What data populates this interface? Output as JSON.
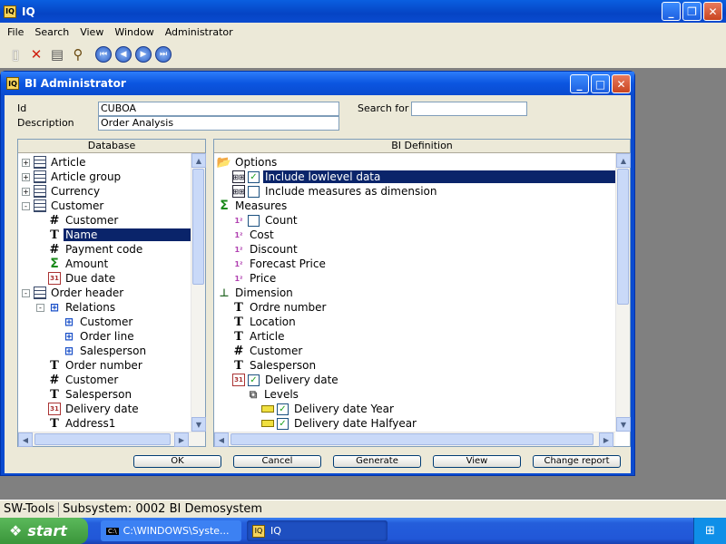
{
  "app": {
    "title": "IQ",
    "menu": [
      "File",
      "Search",
      "View",
      "Window",
      "Administrator"
    ],
    "toolbar_icons": [
      "new-icon",
      "delete-icon",
      "print-icon",
      "search-icon",
      "first-icon",
      "previous-icon",
      "next-icon",
      "last-icon"
    ]
  },
  "dialog": {
    "title": "BI Administrator",
    "id_label": "Id",
    "id_value": "CUBOA",
    "description_label": "Description",
    "description_value": "Order Analysis",
    "search_label": "Search for",
    "search_value": "",
    "database_header": "Database",
    "bi_header": "BI Definition",
    "buttons": {
      "ok": "OK",
      "cancel": "Cancel",
      "generate": "Generate",
      "view": "View",
      "change_report": "Change report"
    }
  },
  "database_tree": [
    {
      "label": "Article",
      "icon": "table",
      "expander": "+",
      "indent": 0
    },
    {
      "label": "Article group",
      "icon": "table",
      "expander": "+",
      "indent": 0
    },
    {
      "label": "Currency",
      "icon": "table",
      "expander": "+",
      "indent": 0
    },
    {
      "label": "Customer",
      "icon": "table",
      "expander": "-",
      "indent": 0
    },
    {
      "label": "Customer",
      "icon": "hash",
      "indent": 1
    },
    {
      "label": "Name",
      "icon": "T",
      "indent": 1,
      "selected": true
    },
    {
      "label": "Payment code",
      "icon": "hash",
      "indent": 1
    },
    {
      "label": "Amount",
      "icon": "sigma",
      "indent": 1
    },
    {
      "label": "Due date",
      "icon": "cal",
      "indent": 1
    },
    {
      "label": "Order header",
      "icon": "table",
      "expander": "-",
      "indent": 0
    },
    {
      "label": "Relations",
      "icon": "rel",
      "expander": "-",
      "indent": 1
    },
    {
      "label": "Customer",
      "icon": "rel",
      "indent": 2
    },
    {
      "label": "Order line",
      "icon": "rel",
      "indent": 2
    },
    {
      "label": "Salesperson",
      "icon": "rel",
      "indent": 2
    },
    {
      "label": "Order number",
      "icon": "T",
      "indent": 1
    },
    {
      "label": "Customer",
      "icon": "hash",
      "indent": 1
    },
    {
      "label": "Salesperson",
      "icon": "T",
      "indent": 1
    },
    {
      "label": "Delivery date",
      "icon": "cal",
      "indent": 1
    },
    {
      "label": "Address1",
      "icon": "T",
      "indent": 1
    }
  ],
  "bi_tree": [
    {
      "label": "Options",
      "icon": "folder",
      "indent": 0
    },
    {
      "label": "Include lowlevel data",
      "icon": "grid",
      "checkbox": true,
      "checked": true,
      "indent": 1,
      "selected": true
    },
    {
      "label": "Include measures as dimension",
      "icon": "grid",
      "checkbox": true,
      "checked": false,
      "indent": 1
    },
    {
      "label": "Measures",
      "icon": "sigma",
      "indent": 0
    },
    {
      "label": "Count",
      "icon": "num",
      "checkbox": true,
      "checked": false,
      "indent": 1
    },
    {
      "label": "Cost",
      "icon": "num",
      "indent": 1
    },
    {
      "label": "Discount",
      "icon": "num",
      "indent": 1
    },
    {
      "label": "Forecast Price",
      "icon": "num",
      "indent": 1
    },
    {
      "label": "Price",
      "icon": "num",
      "indent": 1
    },
    {
      "label": "Dimension",
      "icon": "dim",
      "indent": 0
    },
    {
      "label": "Ordre number",
      "icon": "T",
      "indent": 1
    },
    {
      "label": "Location",
      "icon": "T",
      "indent": 1
    },
    {
      "label": "Article",
      "icon": "T",
      "indent": 1
    },
    {
      "label": "Customer",
      "icon": "hash",
      "indent": 1
    },
    {
      "label": "Salesperson",
      "icon": "T",
      "indent": 1
    },
    {
      "label": "Delivery date",
      "icon": "cal",
      "checkbox": true,
      "checked": true,
      "indent": 1
    },
    {
      "label": "Levels",
      "icon": "lvls",
      "indent": 2
    },
    {
      "label": "Delivery date Year",
      "icon": "flag",
      "checkbox": true,
      "checked": true,
      "indent": 3
    },
    {
      "label": "Delivery date Halfyear",
      "icon": "flag",
      "checkbox": true,
      "checked": true,
      "indent": 3
    }
  ],
  "statusbar": {
    "left": "SW-Tools",
    "right": "Subsystem: 0002 BI Demosystem"
  },
  "taskbar": {
    "start": "start",
    "tasks": [
      "C:\\WINDOWS\\Syste...",
      "IQ"
    ]
  }
}
